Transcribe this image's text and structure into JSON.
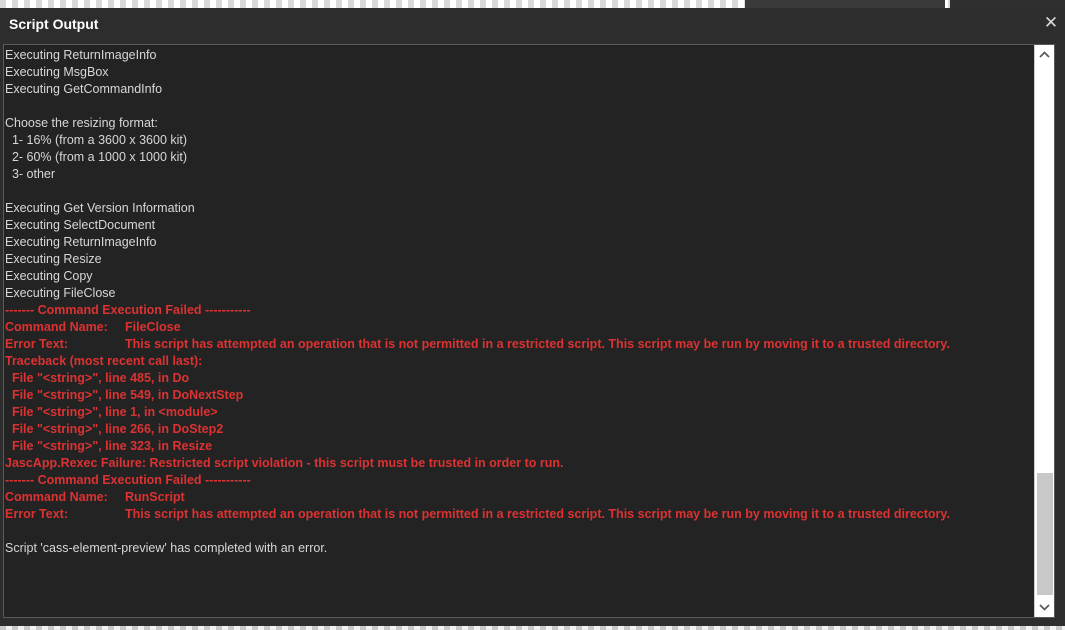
{
  "window": {
    "title": "Script Output",
    "close_glyph": "✕"
  },
  "output": {
    "lines": [
      {
        "type": "normal",
        "text": "Executing ReturnImageInfo"
      },
      {
        "type": "normal",
        "text": "Executing MsgBox"
      },
      {
        "type": "normal",
        "text": "Executing GetCommandInfo"
      },
      {
        "type": "normal",
        "text": ""
      },
      {
        "type": "normal",
        "text": "Choose the resizing format:"
      },
      {
        "type": "normal",
        "text": "  1- 16% (from a 3600 x 3600 kit)"
      },
      {
        "type": "normal",
        "text": "  2- 60% (from a 1000 x 1000 kit)"
      },
      {
        "type": "normal",
        "text": "  3- other"
      },
      {
        "type": "normal",
        "text": ""
      },
      {
        "type": "normal",
        "text": "Executing Get Version Information"
      },
      {
        "type": "normal",
        "text": "Executing SelectDocument"
      },
      {
        "type": "normal",
        "text": "Executing ReturnImageInfo"
      },
      {
        "type": "normal",
        "text": "Executing Resize"
      },
      {
        "type": "normal",
        "text": "Executing Copy"
      },
      {
        "type": "normal",
        "text": "Executing FileClose"
      },
      {
        "type": "error",
        "text": "------- Command Execution Failed -----------"
      },
      {
        "type": "error-kv",
        "label": "Command Name:",
        "value": "FileClose"
      },
      {
        "type": "error-kv",
        "label": "Error Text:",
        "value": "This script has attempted an operation that is not permitted in a restricted script. This script may be run by moving it to a trusted directory."
      },
      {
        "type": "error",
        "text": "Traceback (most recent call last):"
      },
      {
        "type": "error",
        "text": "  File \"<string>\", line 485, in Do"
      },
      {
        "type": "error",
        "text": "  File \"<string>\", line 549, in DoNextStep"
      },
      {
        "type": "error",
        "text": "  File \"<string>\", line 1, in <module>"
      },
      {
        "type": "error",
        "text": "  File \"<string>\", line 266, in DoStep2"
      },
      {
        "type": "error",
        "text": "  File \"<string>\", line 323, in Resize"
      },
      {
        "type": "error",
        "text": "JascApp.Rexec Failure: Restricted script violation - this script must be trusted in order to run."
      },
      {
        "type": "error",
        "text": "------- Command Execution Failed -----------"
      },
      {
        "type": "error-kv",
        "label": "Command Name:",
        "value": "RunScript"
      },
      {
        "type": "error-kv",
        "label": "Error Text:",
        "value": "This script has attempted an operation that is not permitted in a restricted script. This script may be run by moving it to a trusted directory."
      },
      {
        "type": "normal",
        "text": ""
      },
      {
        "type": "normal",
        "text": "Script 'cass-element-preview' has completed with an error."
      }
    ]
  },
  "scrollbar": {
    "up_icon": "chevron-up-icon",
    "down_icon": "chevron-down-icon",
    "position": 0.75
  },
  "colors": {
    "error": "#dc3232",
    "text": "#d7d7d7",
    "background": "#232323"
  }
}
